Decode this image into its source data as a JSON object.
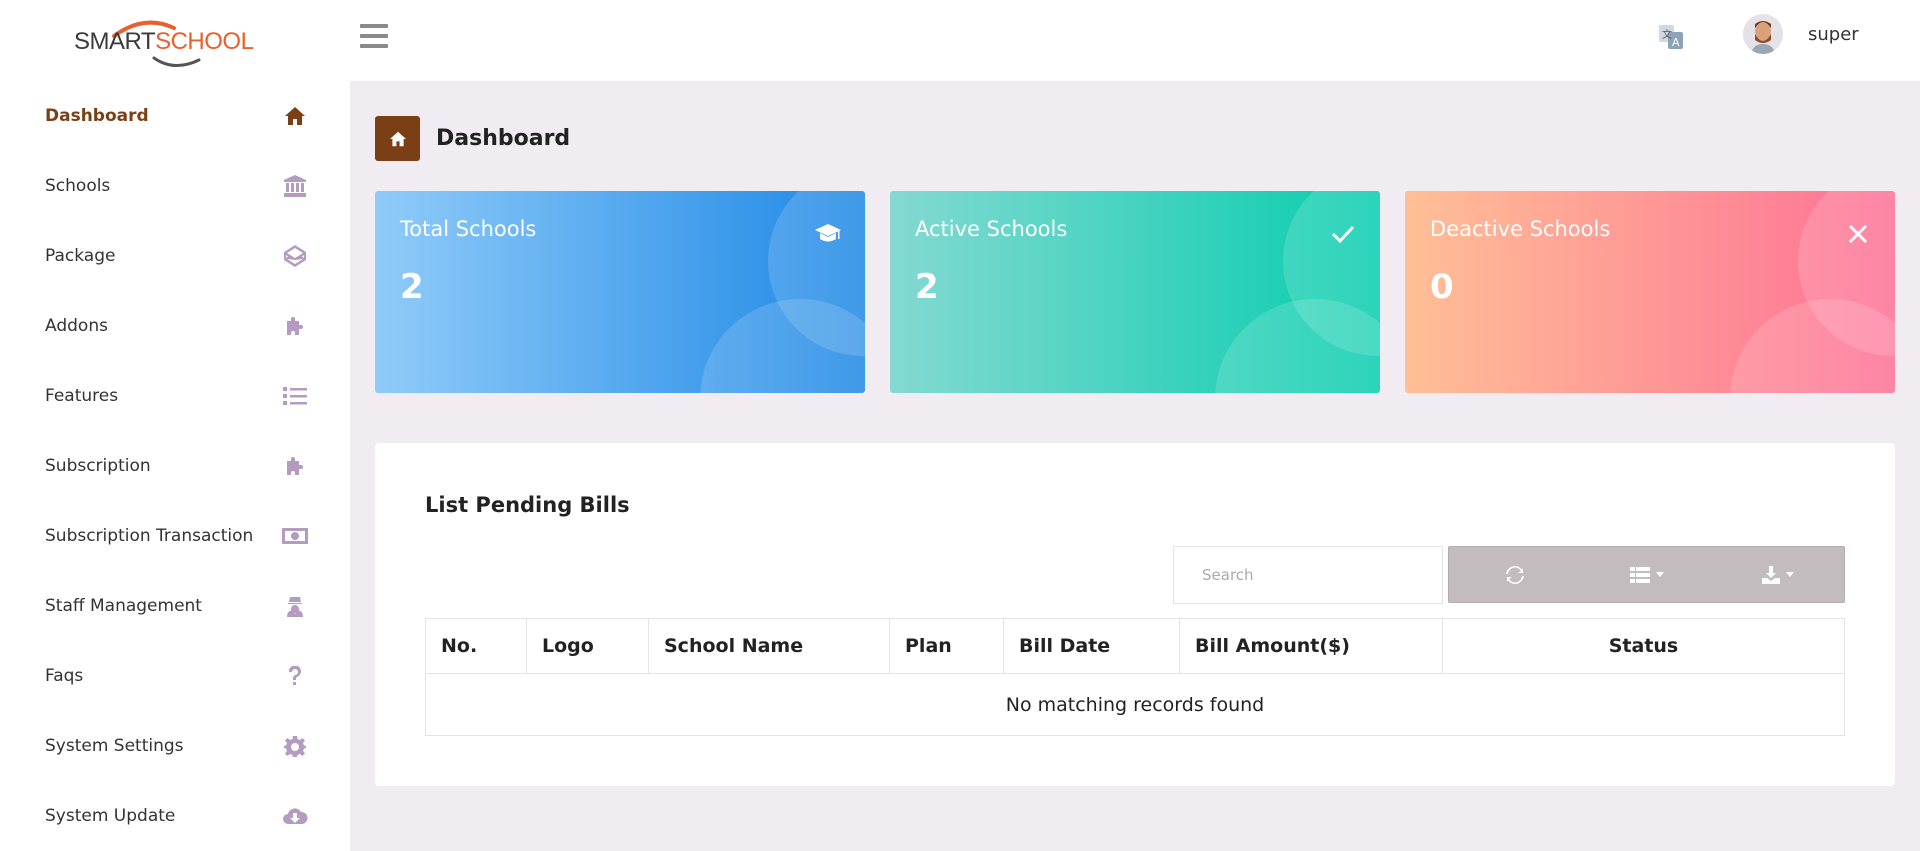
{
  "brand": {
    "logo_part1": "SMART",
    "logo_part2": "SCHOOL"
  },
  "sidebar": {
    "items": [
      {
        "label": "Dashboard",
        "icon": "home-icon",
        "active": true
      },
      {
        "label": "Schools",
        "icon": "bank-icon"
      },
      {
        "label": "Package",
        "icon": "codepen-icon"
      },
      {
        "label": "Addons",
        "icon": "puzzle-icon"
      },
      {
        "label": "Features",
        "icon": "list-icon"
      },
      {
        "label": "Subscription",
        "icon": "puzzle-icon"
      },
      {
        "label": "Subscription Transaction",
        "icon": "money-icon"
      },
      {
        "label": "Staff Management",
        "icon": "user-secret-icon"
      },
      {
        "label": "Faqs",
        "icon": "question-icon"
      },
      {
        "label": "System Settings",
        "icon": "gear-icon"
      },
      {
        "label": "System Update",
        "icon": "cloud-download-icon"
      }
    ]
  },
  "header": {
    "username": "super"
  },
  "page": {
    "title": "Dashboard"
  },
  "cards": {
    "total": {
      "title": "Total Schools",
      "value": "2"
    },
    "active": {
      "title": "Active Schools",
      "value": "2"
    },
    "deactive": {
      "title": "Deactive Schools",
      "value": "0"
    }
  },
  "bills": {
    "title": "List Pending Bills",
    "search_placeholder": "Search",
    "columns": [
      "No.",
      "Logo",
      "School Name",
      "Plan",
      "Bill Date",
      "Bill Amount($)",
      "Status"
    ],
    "empty_message": "No matching records found"
  },
  "colors": {
    "accent": "#7b3f16",
    "sidebar_icon": "#b39cbf",
    "page_bg": "#f1ecf2"
  }
}
